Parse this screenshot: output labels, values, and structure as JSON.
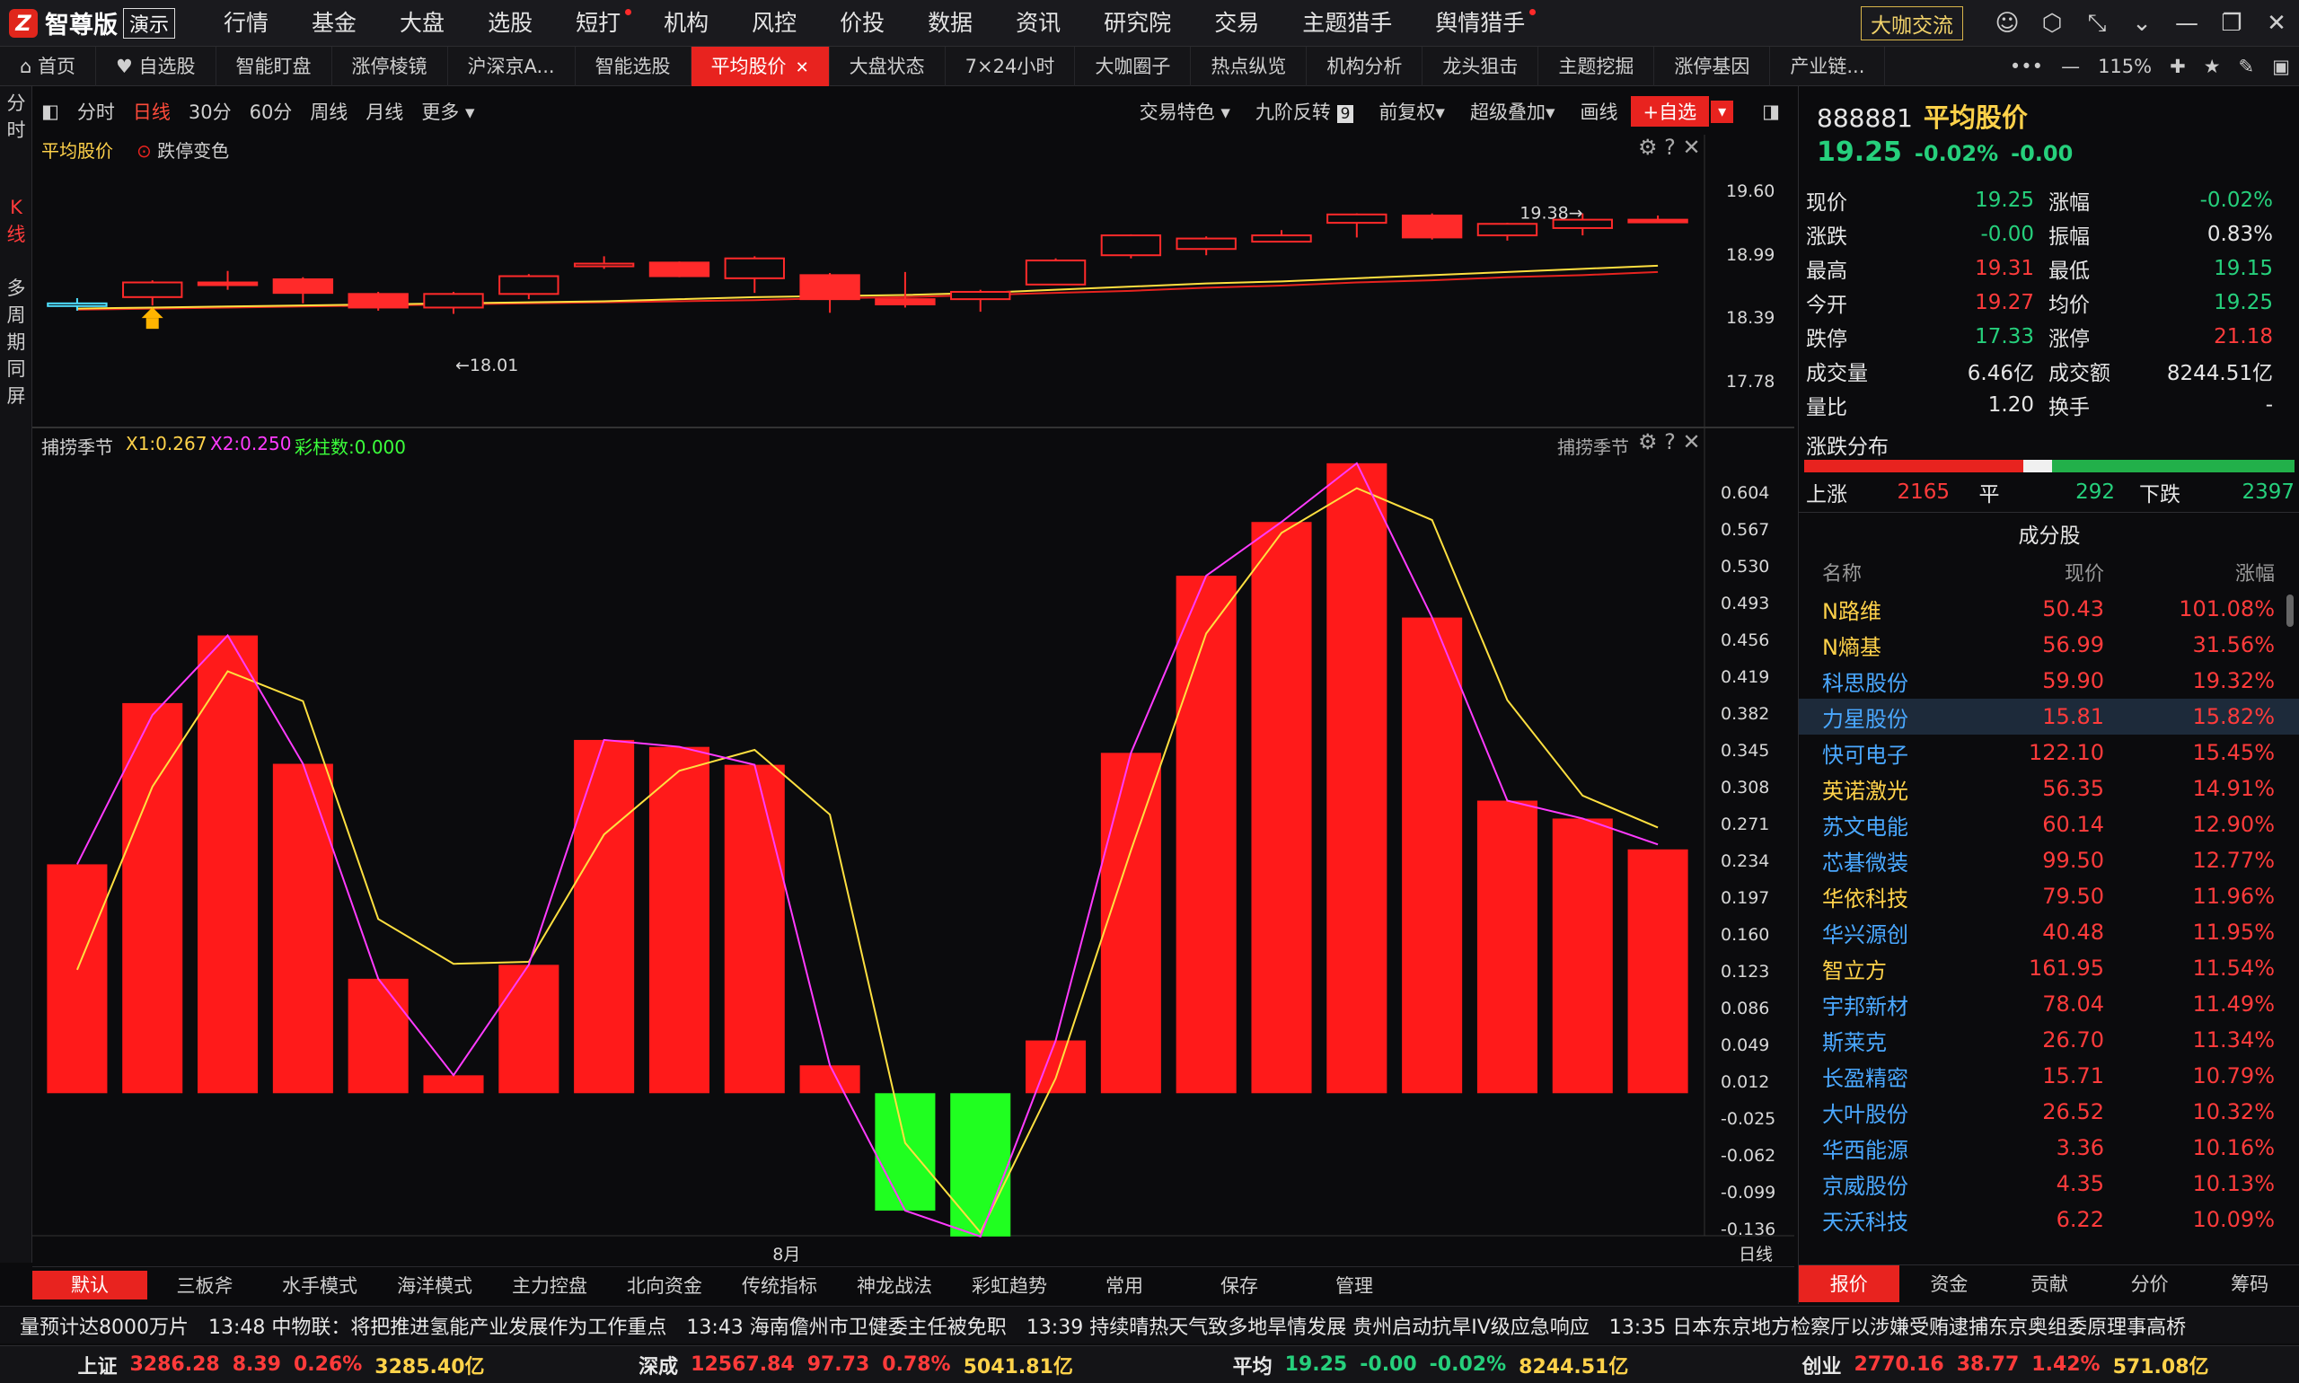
{
  "app": {
    "logo_text": "智尊版",
    "logo_badge": "演示",
    "menu": [
      {
        "label": "行情",
        "dot": false
      },
      {
        "label": "基金",
        "dot": false
      },
      {
        "label": "大盘",
        "dot": false
      },
      {
        "label": "选股",
        "dot": false
      },
      {
        "label": "短打",
        "dot": true
      },
      {
        "label": "机构",
        "dot": false
      },
      {
        "label": "风控",
        "dot": false
      },
      {
        "label": "价投",
        "dot": false
      },
      {
        "label": "数据",
        "dot": false
      },
      {
        "label": "资讯",
        "dot": false
      },
      {
        "label": "研究院",
        "dot": false
      },
      {
        "label": "交易",
        "dot": false
      },
      {
        "label": "主题猎手",
        "dot": false
      },
      {
        "label": "舆情猎手",
        "dot": true
      }
    ],
    "cafe_button": "大咖交流"
  },
  "tabs": [
    {
      "label": "首页",
      "icon": "home-icon"
    },
    {
      "label": "自选股",
      "icon": "heart-icon"
    },
    {
      "label": "智能盯盘"
    },
    {
      "label": "涨停棱镜"
    },
    {
      "label": "沪深京A..."
    },
    {
      "label": "智能选股"
    },
    {
      "label": "平均股价",
      "active": true
    },
    {
      "label": "大盘状态"
    },
    {
      "label": "7×24小时"
    },
    {
      "label": "大咖圈子"
    },
    {
      "label": "热点纵览"
    },
    {
      "label": "机构分析"
    },
    {
      "label": "龙头狙击"
    },
    {
      "label": "主题挖掘"
    },
    {
      "label": "涨停基因"
    },
    {
      "label": "产业链..."
    }
  ],
  "tab_tools": {
    "zoom": "115%"
  },
  "leftbar": {
    "fenshi": [
      "分",
      "时"
    ],
    "kline": [
      "K",
      "线"
    ],
    "multi": [
      "多",
      "周",
      "期",
      "同",
      "屏"
    ]
  },
  "toolbar": {
    "periods": [
      {
        "label": "分时"
      },
      {
        "label": "日线",
        "active": true
      },
      {
        "label": "30分"
      },
      {
        "label": "60分"
      },
      {
        "label": "周线"
      },
      {
        "label": "月线"
      },
      {
        "label": "更多 ▾"
      }
    ],
    "right": [
      "交易特色 ▾",
      "九阶反转",
      "前复权▾",
      "超级叠加▾",
      "画线"
    ],
    "nine_badge": "9",
    "add_fav": "+自选"
  },
  "main_panel": {
    "title": "平均股价",
    "sub": "跌停变色",
    "y_ticks": [
      "19.60",
      "18.99",
      "18.39",
      "17.78"
    ],
    "high_label": "19.38",
    "low_label": "18.01"
  },
  "indicator_panel": {
    "title": "捕捞季节",
    "x1": "X1:0.267",
    "x2": "X2:0.250",
    "count": "彩柱数:0.000",
    "right_title": "捕捞季节",
    "y_ticks": [
      "0.604",
      "0.567",
      "0.530",
      "0.493",
      "0.456",
      "0.419",
      "0.382",
      "0.345",
      "0.308",
      "0.271",
      "0.234",
      "0.197",
      "0.160",
      "0.123",
      "0.086",
      "0.049",
      "0.012",
      "-0.025",
      "-0.062",
      "-0.099",
      "-0.136"
    ],
    "month_label": "8月",
    "period_label": "日线"
  },
  "chart_data": {
    "type": "candlestick",
    "candles": [
      {
        "o": 18.52,
        "c": 18.52,
        "h": 18.57,
        "l": 18.45,
        "color": "cyan"
      },
      {
        "o": 18.58,
        "c": 18.72,
        "h": 18.74,
        "l": 18.5,
        "color": "red-hollow"
      },
      {
        "o": 18.72,
        "c": 18.72,
        "h": 18.83,
        "l": 18.65,
        "color": "red"
      },
      {
        "o": 18.75,
        "c": 18.62,
        "h": 18.77,
        "l": 18.52,
        "color": "red"
      },
      {
        "o": 18.61,
        "c": 18.48,
        "h": 18.63,
        "l": 18.45,
        "color": "red"
      },
      {
        "o": 18.48,
        "c": 18.61,
        "h": 18.63,
        "l": 18.42,
        "color": "red-hollow"
      },
      {
        "o": 18.61,
        "c": 18.78,
        "h": 18.8,
        "l": 18.56,
        "color": "red-hollow"
      },
      {
        "o": 18.88,
        "c": 18.9,
        "h": 18.97,
        "l": 18.85,
        "color": "red-hollow"
      },
      {
        "o": 18.91,
        "c": 18.78,
        "h": 18.92,
        "l": 18.77,
        "color": "red"
      },
      {
        "o": 18.95,
        "c": 18.76,
        "h": 18.97,
        "l": 18.62,
        "color": "red-hollow"
      },
      {
        "o": 18.79,
        "c": 18.56,
        "h": 18.81,
        "l": 18.43,
        "color": "red"
      },
      {
        "o": 18.56,
        "c": 18.51,
        "h": 18.82,
        "l": 18.48,
        "color": "red"
      },
      {
        "o": 18.56,
        "c": 18.63,
        "h": 18.65,
        "l": 18.44,
        "color": "red-hollow"
      },
      {
        "o": 18.7,
        "c": 18.93,
        "h": 18.95,
        "l": 18.7,
        "color": "red-hollow"
      },
      {
        "o": 18.98,
        "c": 19.17,
        "h": 19.18,
        "l": 18.95,
        "color": "red-hollow"
      },
      {
        "o": 19.04,
        "c": 19.14,
        "h": 19.16,
        "l": 18.98,
        "color": "red-hollow"
      },
      {
        "o": 19.11,
        "c": 19.17,
        "h": 19.22,
        "l": 19.11,
        "color": "red-hollow"
      },
      {
        "o": 19.29,
        "c": 19.37,
        "h": 19.38,
        "l": 19.15,
        "color": "red-hollow"
      },
      {
        "o": 19.36,
        "c": 19.15,
        "h": 19.38,
        "l": 19.13,
        "color": "red"
      },
      {
        "o": 19.28,
        "c": 19.17,
        "h": 19.29,
        "l": 19.12,
        "color": "red-hollow"
      },
      {
        "o": 19.24,
        "c": 19.32,
        "h": 19.38,
        "l": 19.17,
        "color": "red-hollow"
      },
      {
        "o": 19.31,
        "c": 19.32,
        "h": 19.36,
        "l": 19.29,
        "color": "red"
      }
    ],
    "ma_yellow": [
      18.47,
      18.48,
      18.49,
      18.5,
      18.51,
      18.52,
      18.53,
      18.54,
      18.56,
      18.58,
      18.59,
      18.6,
      18.62,
      18.65,
      18.68,
      18.71,
      18.73,
      18.76,
      18.79,
      18.82,
      18.85,
      18.88
    ],
    "ma_red": [
      18.46,
      18.47,
      18.48,
      18.49,
      18.5,
      18.51,
      18.52,
      18.53,
      18.54,
      18.55,
      18.57,
      18.58,
      18.6,
      18.62,
      18.64,
      18.67,
      18.69,
      18.72,
      18.74,
      18.77,
      18.79,
      18.82
    ],
    "y_range": [
      17.78,
      19.6
    ],
    "indicator": {
      "bars": [
        0.23,
        0.392,
        0.46,
        0.331,
        0.115,
        0.018,
        0.129,
        0.355,
        0.348,
        0.33,
        0.028,
        -0.118,
        -0.144,
        0.053,
        0.342,
        0.52,
        0.574,
        0.633,
        0.478,
        0.294,
        0.276,
        0.245
      ],
      "x1": [
        0.124,
        0.308,
        0.424,
        0.394,
        0.175,
        0.13,
        0.132,
        0.26,
        0.324,
        0.345,
        0.28,
        -0.05,
        -0.14,
        0.015,
        0.244,
        0.462,
        0.563,
        0.608,
        0.576,
        0.395,
        0.299,
        0.267
      ],
      "x2": [
        0.23,
        0.38,
        0.46,
        0.331,
        0.115,
        0.018,
        0.129,
        0.355,
        0.348,
        0.33,
        0.028,
        -0.118,
        -0.144,
        0.053,
        0.342,
        0.52,
        0.574,
        0.633,
        0.478,
        0.294,
        0.276,
        0.25
      ],
      "y_range": [
        -0.136,
        0.604
      ]
    }
  },
  "quote": {
    "code": "888881",
    "name": "平均股价",
    "price": "19.25",
    "pct": "-0.02%",
    "chg": "-0.00",
    "rows": [
      {
        "k1": "现价",
        "v1": "19.25",
        "c1": "green",
        "k2": "涨幅",
        "v2": "-0.02%",
        "c2": "green"
      },
      {
        "k1": "涨跌",
        "v1": "-0.00",
        "c1": "green",
        "k2": "振幅",
        "v2": "0.83%",
        "c2": "white"
      },
      {
        "k1": "最高",
        "v1": "19.31",
        "c1": "red",
        "k2": "最低",
        "v2": "19.15",
        "c2": "green"
      },
      {
        "k1": "今开",
        "v1": "19.27",
        "c1": "red",
        "k2": "均价",
        "v2": "19.25",
        "c2": "green"
      },
      {
        "k1": "跌停",
        "v1": "17.33",
        "c1": "green",
        "k2": "涨停",
        "v2": "21.18",
        "c2": "red"
      },
      {
        "k1": "成交量",
        "v1": "6.46亿",
        "c1": "white",
        "k2": "成交额",
        "v2": "8244.51亿",
        "c2": "white"
      },
      {
        "k1": "量比",
        "v1": "1.20",
        "c1": "white",
        "k2": "换手",
        "v2": "-",
        "c2": "white"
      }
    ]
  },
  "distribution": {
    "title": "涨跌分布",
    "up_label": "上涨",
    "up": "2165",
    "flat_label": "平",
    "flat": "292",
    "down_label": "下跌",
    "down": "2397"
  },
  "constituents": {
    "title": "成分股",
    "cols": [
      "名称",
      "现价",
      "涨幅"
    ],
    "rows": [
      {
        "name": "N路维",
        "price": "50.43",
        "pct": "101.08%",
        "color": "yellow"
      },
      {
        "name": "N熵基",
        "price": "56.99",
        "pct": "31.56%",
        "color": "yellow"
      },
      {
        "name": "科思股份",
        "price": "59.90",
        "pct": "19.32%",
        "color": "blue"
      },
      {
        "name": "力星股份",
        "price": "15.81",
        "pct": "15.82%",
        "color": "blue",
        "sel": true
      },
      {
        "name": "快可电子",
        "price": "122.10",
        "pct": "15.45%",
        "color": "blue"
      },
      {
        "name": "英诺激光",
        "price": "56.35",
        "pct": "14.91%",
        "color": "yellow"
      },
      {
        "name": "苏文电能",
        "price": "60.14",
        "pct": "12.90%",
        "color": "blue"
      },
      {
        "name": "芯碁微装",
        "price": "99.50",
        "pct": "12.77%",
        "color": "blue"
      },
      {
        "name": "华依科技",
        "price": "79.50",
        "pct": "11.96%",
        "color": "yellow"
      },
      {
        "name": "华兴源创",
        "price": "40.48",
        "pct": "11.95%",
        "color": "blue"
      },
      {
        "name": "智立方",
        "price": "161.95",
        "pct": "11.54%",
        "color": "yellow"
      },
      {
        "name": "宇邦新材",
        "price": "78.04",
        "pct": "11.49%",
        "color": "blue"
      },
      {
        "name": "斯莱克",
        "price": "26.70",
        "pct": "11.34%",
        "color": "blue"
      },
      {
        "name": "长盈精密",
        "price": "15.71",
        "pct": "10.79%",
        "color": "blue"
      },
      {
        "name": "大叶股份",
        "price": "26.52",
        "pct": "10.32%",
        "color": "blue"
      },
      {
        "name": "华西能源",
        "price": "3.36",
        "pct": "10.16%",
        "color": "blue"
      },
      {
        "name": "京威股份",
        "price": "4.35",
        "pct": "10.13%",
        "color": "blue"
      },
      {
        "name": "天沃科技",
        "price": "6.22",
        "pct": "10.09%",
        "color": "blue"
      }
    ]
  },
  "right_tabs": [
    "报价",
    "资金",
    "贡献",
    "分价",
    "筹码"
  ],
  "indicator_tabs": [
    "默认",
    "三板斧",
    "水手模式",
    "海洋模式",
    "主力控盘",
    "北向资金",
    "传统指标",
    "神龙战法",
    "彩虹趋势",
    "常用",
    "保存",
    "管理"
  ],
  "ticker": [
    "量预计达8000万片",
    "13:48 中物联：将把推进氢能产业发展作为工作重点",
    "13:43 海南儋州市卫健委主任被免职",
    "13:39 持续晴热天气致多地旱情发展 贵州启动抗旱IV级应急响应",
    "13:35 日本东京地方检察厅以涉嫌受贿逮捕东京奥组委原理事高桥"
  ],
  "indices": [
    {
      "name": "上证",
      "price": "3286.28",
      "chg": "8.39",
      "pct": "0.26%",
      "amt": "3285.40亿",
      "color": "red"
    },
    {
      "name": "深成",
      "price": "12567.84",
      "chg": "97.73",
      "pct": "0.78%",
      "amt": "5041.81亿",
      "color": "red"
    },
    {
      "name": "平均",
      "price": "19.25",
      "chg": "-0.00",
      "pct": "-0.02%",
      "amt": "8244.51亿",
      "color": "green"
    },
    {
      "name": "创业",
      "price": "2770.16",
      "chg": "38.77",
      "pct": "1.42%",
      "amt": "571.08亿",
      "color": "red"
    }
  ]
}
